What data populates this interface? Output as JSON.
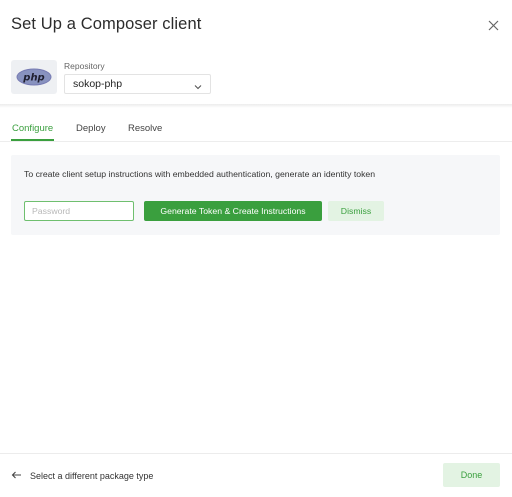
{
  "dialog": {
    "title": "Set Up a Composer client",
    "close_icon": "close-icon"
  },
  "repository": {
    "logo_icon": "php-logo-icon",
    "logo_text": "php",
    "label": "Repository",
    "selected": "sokop-php",
    "dropdown_icon": "chevron-down-icon"
  },
  "tabs": [
    {
      "label": "Configure",
      "active": true
    },
    {
      "label": "Deploy",
      "active": false
    },
    {
      "label": "Resolve",
      "active": false
    }
  ],
  "configure": {
    "instructions": "To create client setup instructions with embedded authentication, generate an identity token",
    "password_placeholder": "Password",
    "password_value": "",
    "generate_button": "Generate Token & Create Instructions",
    "dismiss_button": "Dismiss"
  },
  "footer": {
    "back_icon": "arrow-left-icon",
    "back_label": "Select a different package type",
    "done_button": "Done"
  },
  "colors": {
    "accent": "#3a9f3e",
    "accent_light": "#e3f3e3",
    "panel_bg": "#f6f7f9",
    "php_logo": "#777bb3"
  }
}
